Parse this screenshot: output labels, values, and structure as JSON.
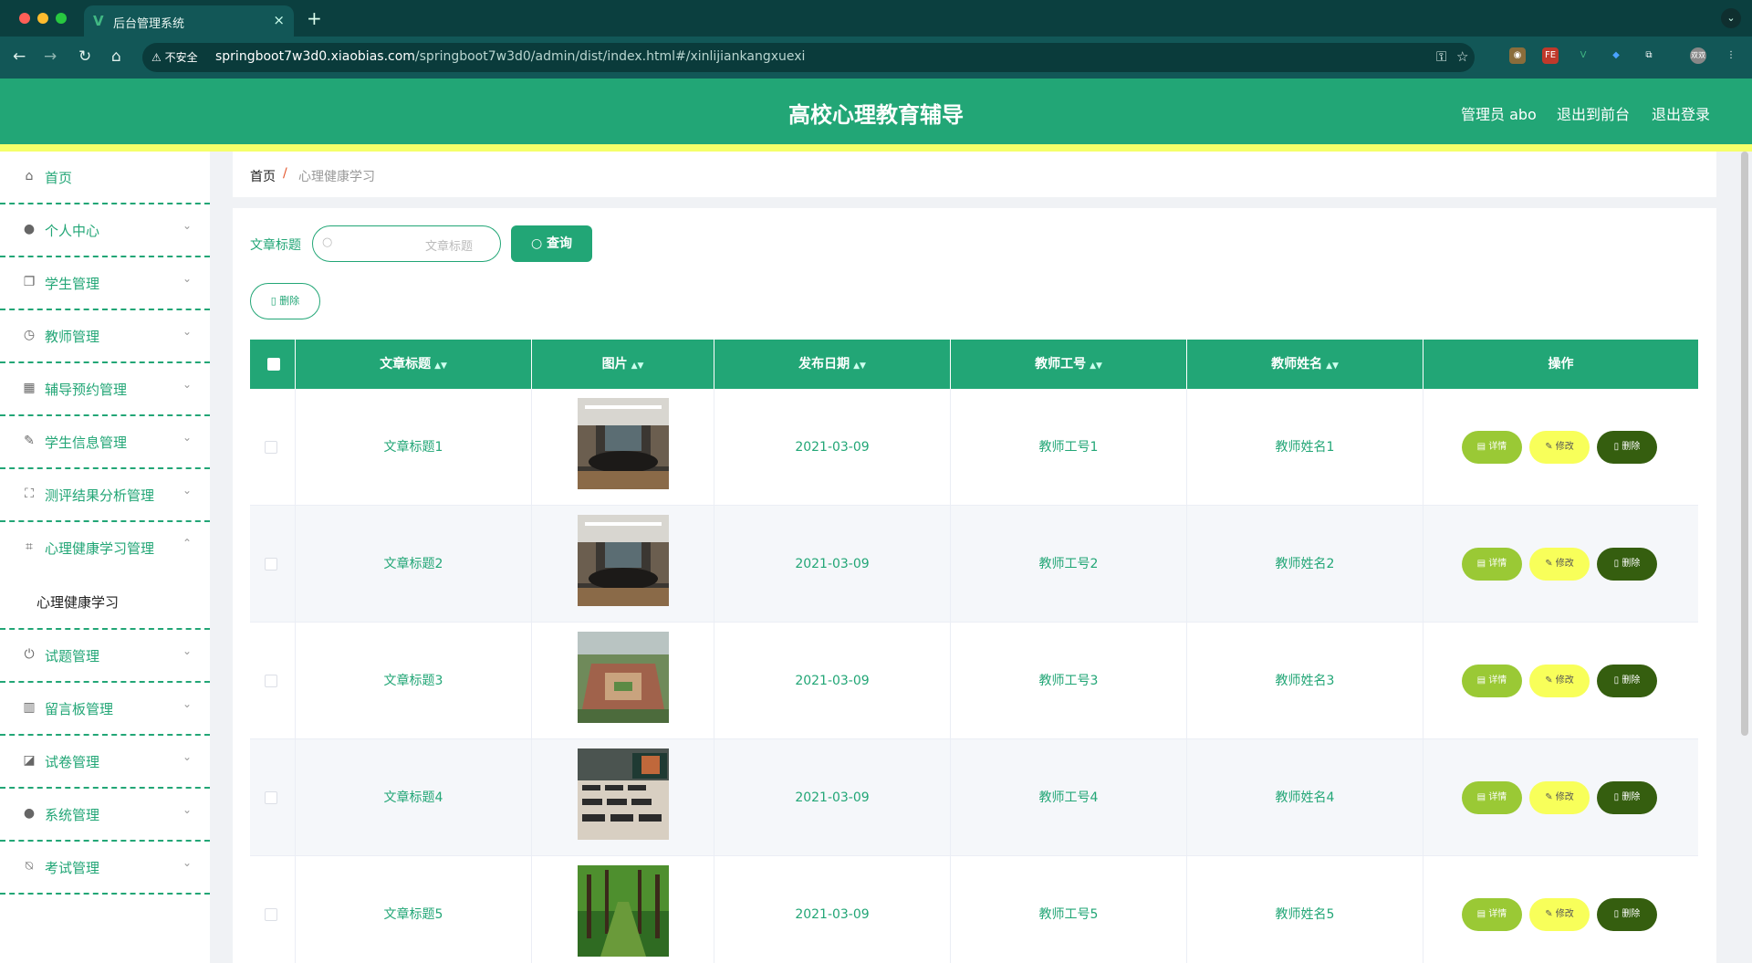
{
  "browser": {
    "tab_title": "后台管理系统",
    "tab_logo": "V",
    "tab_close": "×",
    "new_tab": "+",
    "tab_menu": "⌄",
    "insecure_label": "不安全",
    "url_host": "springboot7w3d0.xiaobias.com",
    "url_path": "/springboot7w3d0/admin/dist/index.html#/xinlijiankangxuexi",
    "extensions": [
      "FE",
      "V",
      "双双"
    ]
  },
  "header": {
    "title": "高校心理教育辅导",
    "user_label": "管理员 abo",
    "front_link": "退出到前台",
    "logout_link": "退出登录"
  },
  "sidebar": {
    "items": [
      {
        "label": "首页",
        "icon": "home-icon",
        "glyph": "⌂",
        "arrow": ""
      },
      {
        "label": "个人中心",
        "icon": "user-icon",
        "glyph": "●",
        "arrow": "⌄"
      },
      {
        "label": "学生管理",
        "icon": "copy-icon",
        "glyph": "❐",
        "arrow": "⌄"
      },
      {
        "label": "教师管理",
        "icon": "clock-icon",
        "glyph": "◷",
        "arrow": "⌄"
      },
      {
        "label": "辅导预约管理",
        "icon": "grid-icon",
        "glyph": "▦",
        "arrow": "⌄"
      },
      {
        "label": "学生信息管理",
        "icon": "brush-icon",
        "glyph": "✎",
        "arrow": "⌄"
      },
      {
        "label": "测评结果分析管理",
        "icon": "fullscreen-icon",
        "glyph": "⛶",
        "arrow": "⌄"
      },
      {
        "label": "心理健康学习管理",
        "icon": "crop-icon",
        "glyph": "⌗",
        "arrow": "⌃"
      }
    ],
    "sub_item": "心理健康学习",
    "items_after": [
      {
        "label": "试题管理",
        "icon": "power-icon",
        "glyph": "⏻",
        "arrow": "⌄"
      },
      {
        "label": "留言板管理",
        "icon": "bar-chart-icon",
        "glyph": "▥",
        "arrow": "⌄"
      },
      {
        "label": "试卷管理",
        "icon": "line-chart-icon",
        "glyph": "◪",
        "arrow": "⌄"
      },
      {
        "label": "系统管理",
        "icon": "user-icon",
        "glyph": "●",
        "arrow": "⌄"
      },
      {
        "label": "考试管理",
        "icon": "bell-off-icon",
        "glyph": "⍉",
        "arrow": "⌄"
      }
    ]
  },
  "breadcrumb": {
    "home": "首页",
    "separator": "/",
    "current": "心理健康学习"
  },
  "search": {
    "label": "文章标题",
    "placeholder": "文章标题",
    "button": "查询"
  },
  "bulk_delete": "删除",
  "table": {
    "columns": [
      "文章标题",
      "图片",
      "发布日期",
      "教师工号",
      "教师姓名",
      "操作"
    ],
    "rows": [
      {
        "title": "文章标题1",
        "date": "2021-03-09",
        "teacher_id": "教师工号1",
        "teacher_name": "教师姓名1",
        "image": "conference-room"
      },
      {
        "title": "文章标题2",
        "date": "2021-03-09",
        "teacher_id": "教师工号2",
        "teacher_name": "教师姓名2",
        "image": "conference-room"
      },
      {
        "title": "文章标题3",
        "date": "2021-03-09",
        "teacher_id": "教师工号3",
        "teacher_name": "教师姓名3",
        "image": "campus-aerial"
      },
      {
        "title": "文章标题4",
        "date": "2021-03-09",
        "teacher_id": "教师工号4",
        "teacher_name": "教师姓名4",
        "image": "classroom"
      },
      {
        "title": "文章标题5",
        "date": "2021-03-09",
        "teacher_id": "教师工号5",
        "teacher_name": "教师姓名5",
        "image": "tree-lined-path"
      }
    ],
    "actions": {
      "detail": "详情",
      "edit": "修改",
      "delete": "删除"
    }
  },
  "colors": {
    "primary": "#22a676",
    "accent_yellow": "#f5ff6a",
    "detail": "#9ac935",
    "edit": "#f8ff5a",
    "delete": "#355e0f"
  }
}
